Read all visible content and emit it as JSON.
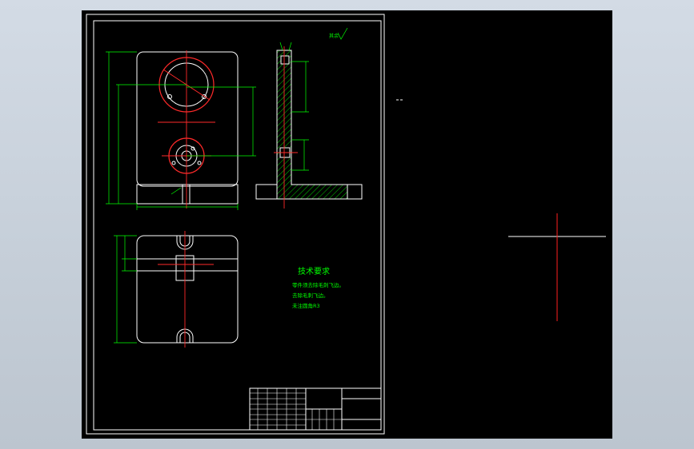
{
  "technical_requirements": {
    "title": "技术要求",
    "items": [
      "零件须去除毛刺飞边。",
      "去除毛刺飞边。",
      "未注圆角R3"
    ]
  },
  "surface_finish_note": "其余",
  "colors": {
    "viewport_background": "#000000",
    "outline": "#ffffff",
    "dimension": "#00ff00",
    "centerline": "#ff2a2a",
    "app_background": "#c6cfd9"
  },
  "icons": {
    "crosshair": "crosshair-cursor-icon",
    "roughness": "surface-roughness-icon"
  }
}
